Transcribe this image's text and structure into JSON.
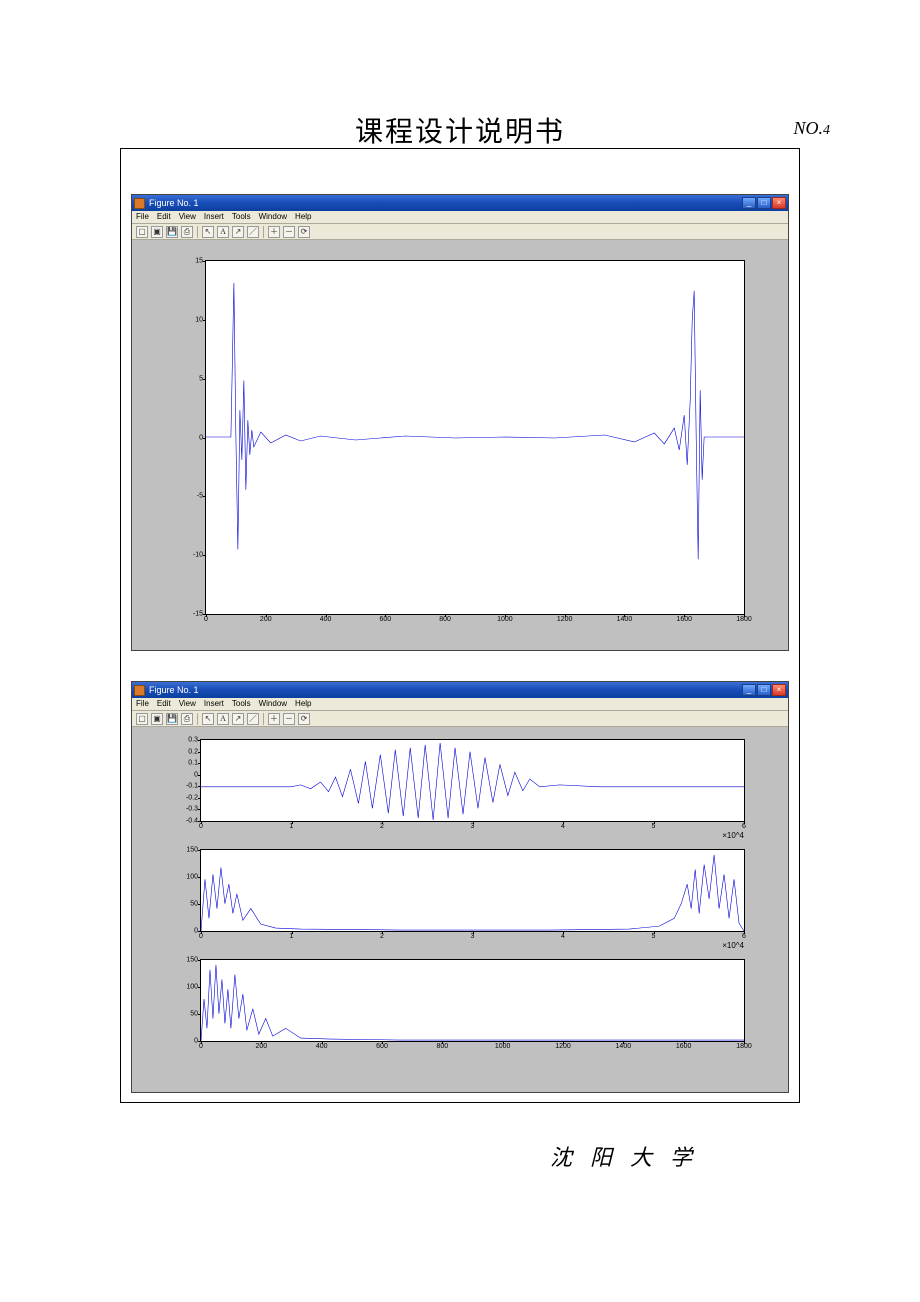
{
  "header": {
    "title": "课程设计说明书",
    "page_no_prefix": "NO.",
    "page_no": "4"
  },
  "footer": {
    "text": "沈阳大学"
  },
  "fig1": {
    "title": "Figure No. 1",
    "menus": [
      "File",
      "Edit",
      "View",
      "Insert",
      "Tools",
      "Window",
      "Help"
    ],
    "winbtns": {
      "min": "_",
      "max": "□",
      "close": "×"
    }
  },
  "fig2": {
    "title": "Figure No. 1",
    "menus": [
      "File",
      "Edit",
      "View",
      "Insert",
      "Tools",
      "Window",
      "Help"
    ],
    "winbtns": {
      "min": "_",
      "max": "□",
      "close": "×"
    }
  },
  "chart_data": [
    {
      "type": "line",
      "title": "",
      "xlabel": "",
      "ylabel": "",
      "xlim": [
        0,
        1800
      ],
      "ylim": [
        -15,
        15
      ],
      "xticks": [
        0,
        200,
        400,
        600,
        800,
        1000,
        1200,
        1400,
        1600,
        1800
      ],
      "yticks": [
        -15,
        -10,
        -5,
        0,
        5,
        10,
        15
      ],
      "description": "Magnitude spectrum: near-zero baseline with two tall spike clusters around x≈100 reaching ±13 and around x≈1620 reaching −10/+13, low amplitude noise (~±1) between them."
    },
    {
      "type": "line",
      "title": "",
      "xlabel": "",
      "ylabel": "",
      "xlim": [
        0,
        6
      ],
      "ylim": [
        -0.4,
        0.3
      ],
      "xticks": [
        0,
        1,
        2,
        3,
        4,
        5,
        6
      ],
      "yticks": [
        -0.4,
        -0.3,
        -0.2,
        -0.1,
        0,
        0.1,
        0.2,
        0.3
      ],
      "x_exponent": "×10^4",
      "description": "Time-domain waveform: quiet 0–1.3, growing oscillation 1.3–3.6 peaking ~±0.3, tapering to quiet after 4.5."
    },
    {
      "type": "line",
      "title": "",
      "xlabel": "",
      "ylabel": "",
      "xlim": [
        0,
        6
      ],
      "ylim": [
        0,
        150
      ],
      "xticks": [
        0,
        1,
        2,
        3,
        4,
        5,
        6
      ],
      "yticks": [
        0,
        50,
        100,
        150
      ],
      "x_exponent": "×10^4",
      "description": "Spectrum magnitude (symmetric): cluster of peaks 0–0.7 up to ~100, low floor 0.7–5.3, mirror cluster 5.3–6 peaking ~150."
    },
    {
      "type": "line",
      "title": "",
      "xlabel": "",
      "ylabel": "",
      "xlim": [
        0,
        1800
      ],
      "ylim": [
        0,
        150
      ],
      "xticks": [
        0,
        200,
        400,
        600,
        800,
        1000,
        1200,
        1400,
        1600,
        1800
      ],
      "yticks": [
        0,
        50,
        100,
        150
      ],
      "description": "Half-spectrum magnitude: peaks clustered 10–200 reaching up to ~140, low floor after 300."
    }
  ]
}
